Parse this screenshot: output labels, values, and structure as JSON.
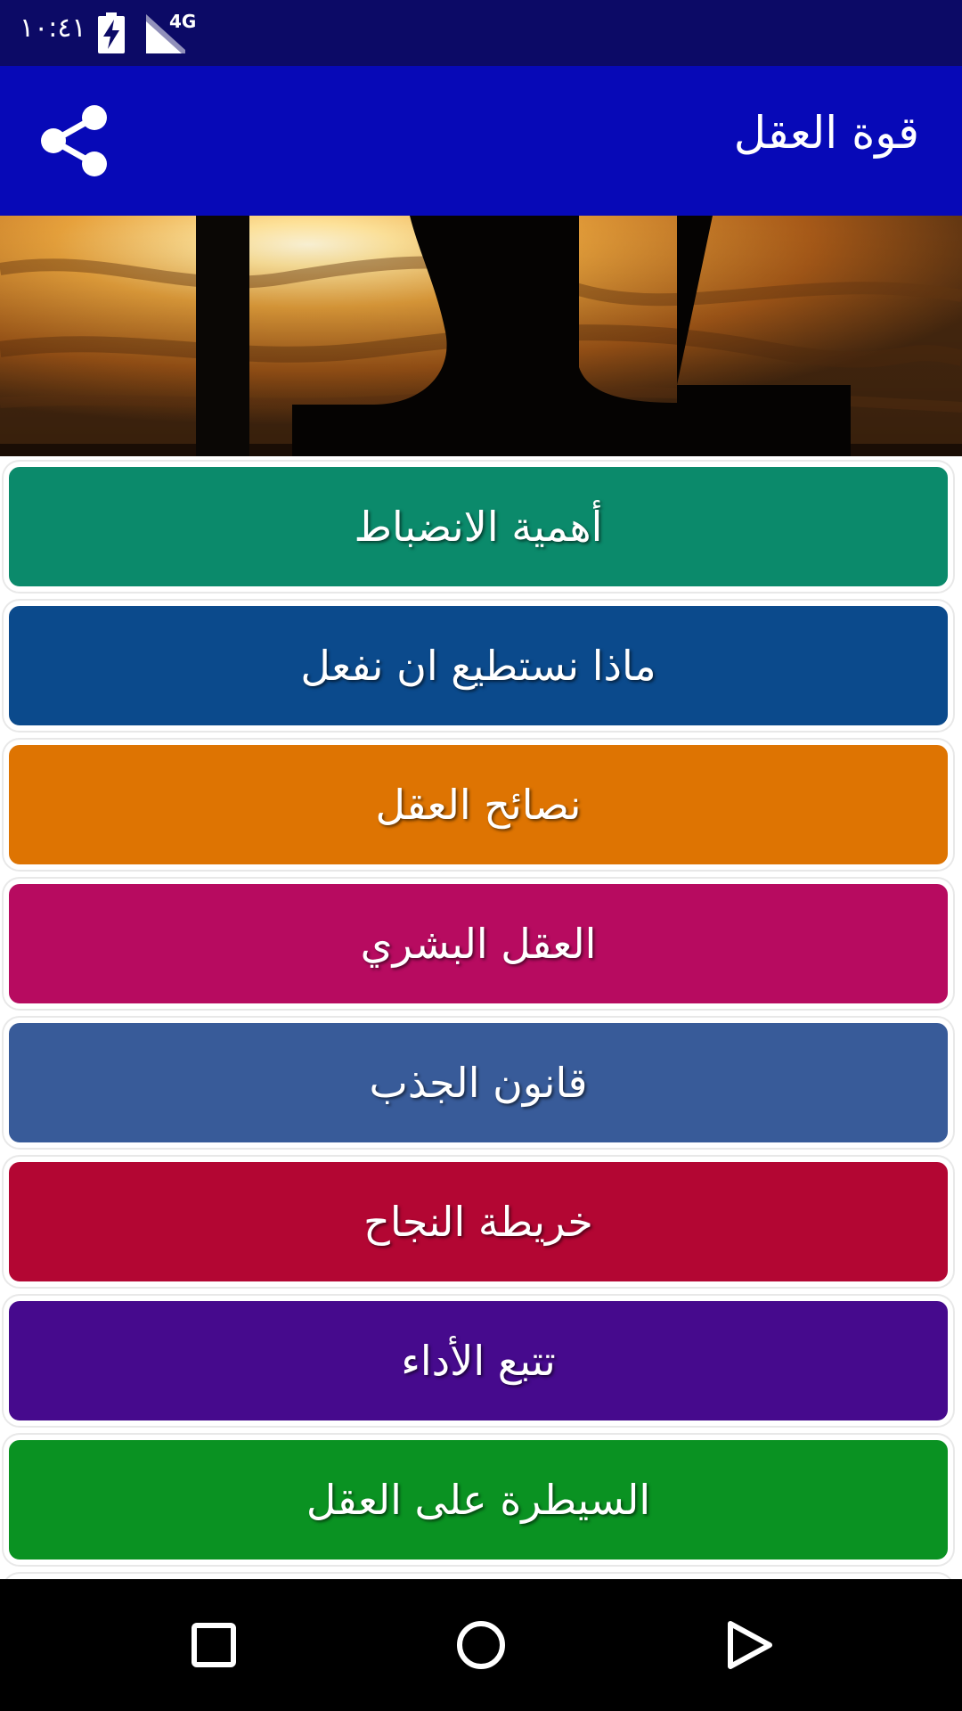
{
  "status_bar": {
    "time": "١٠:٤١",
    "network": "4G",
    "icons": [
      "battery-charging-icon",
      "signal-icon"
    ]
  },
  "app_bar": {
    "title": "قوة العقل",
    "share_icon": "share-icon",
    "background": "#0709b7"
  },
  "banner": {
    "icon": "sunset-silhouette-image"
  },
  "menu": {
    "items": [
      {
        "label": "أهمية الانضباط",
        "color": "#0b8a6b"
      },
      {
        "label": "ماذا نستطيع ان نفعل",
        "color": "#0b4a8c"
      },
      {
        "label": "نصائح العقل",
        "color": "#de7402"
      },
      {
        "label": "العقل البشري",
        "color": "#b70b60"
      },
      {
        "label": "قانون الجذب",
        "color": "#385b99"
      },
      {
        "label": "خريطة النجاح",
        "color": "#b30633"
      },
      {
        "label": "تتبع الأداء",
        "color": "#460a8d"
      },
      {
        "label": "السيطرة على العقل",
        "color": "#0a9222"
      }
    ]
  },
  "nav_bar": {
    "icons": [
      "recents-square-icon",
      "home-circle-icon",
      "back-triangle-icon"
    ]
  }
}
